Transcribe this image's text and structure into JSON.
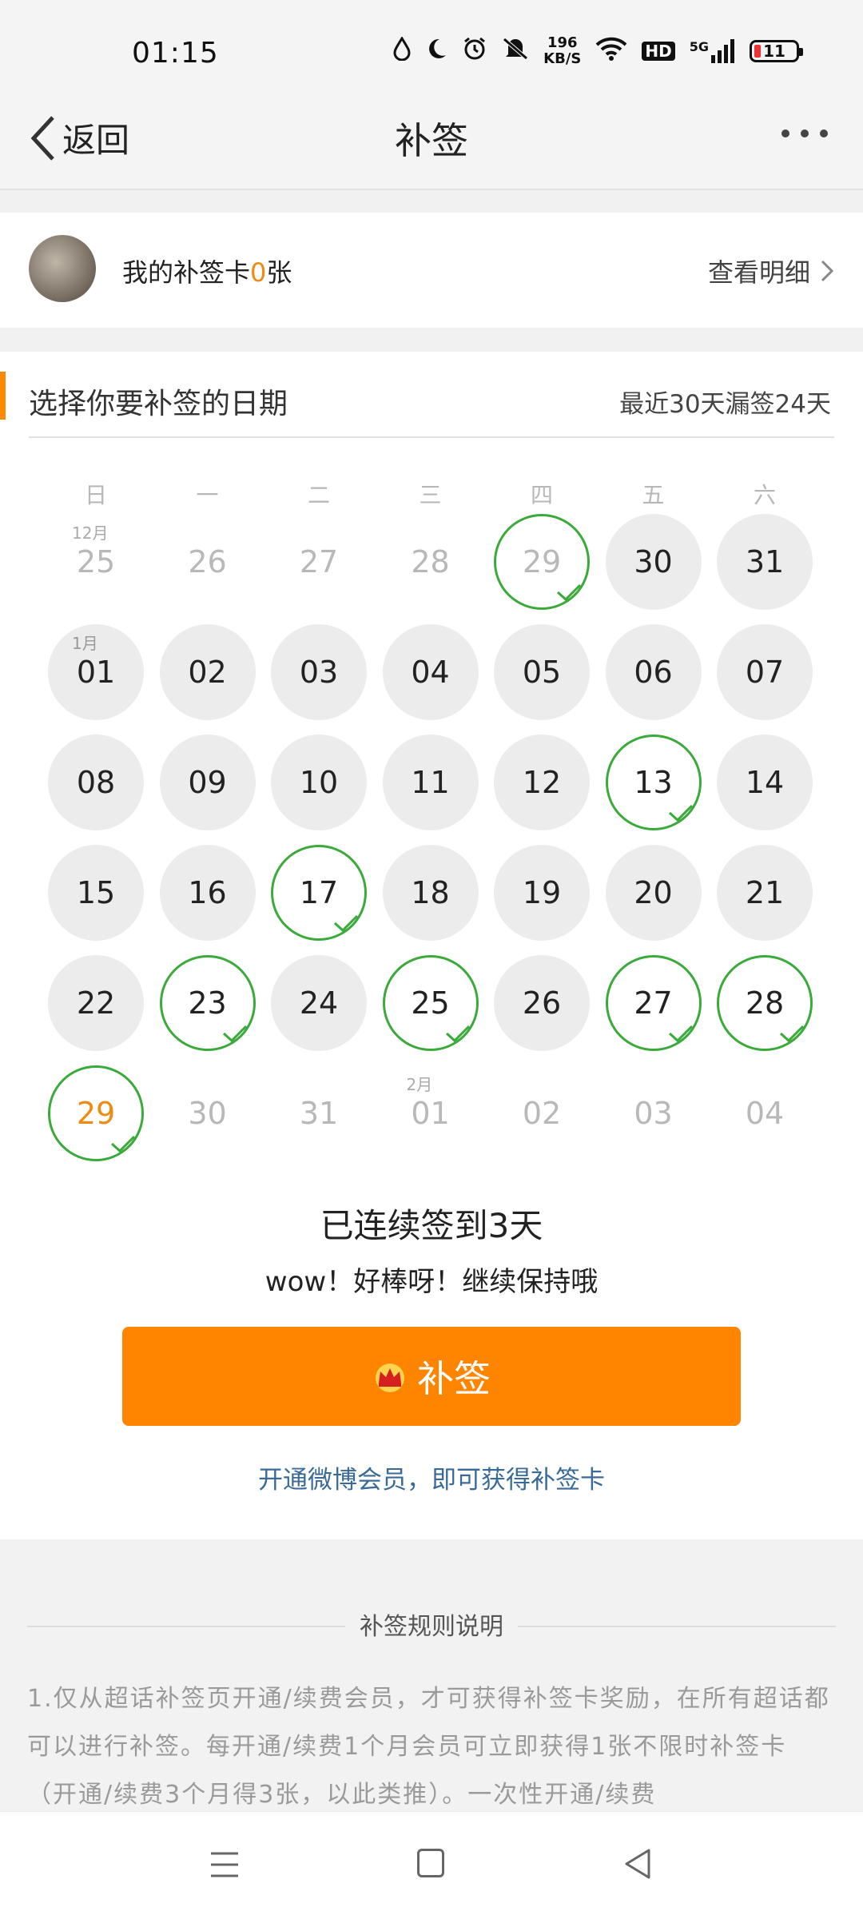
{
  "status_bar": {
    "time": "01:15",
    "net_speed_value": "196",
    "net_speed_unit": "KB/S",
    "hd_label": "HD",
    "network_label": "5G",
    "battery": "11"
  },
  "nav": {
    "back_label": "返回",
    "title": "补签"
  },
  "card": {
    "prefix": "我的补签卡",
    "count": "0",
    "suffix": "张",
    "detail_label": "查看明细"
  },
  "section": {
    "title": "选择你要补签的日期",
    "summary": "最近30天漏签24天"
  },
  "calendar": {
    "weekdays": [
      "日",
      "一",
      "二",
      "三",
      "四",
      "五",
      "六"
    ],
    "weeks": [
      [
        {
          "d": "25",
          "s": "dim",
          "m": "12月"
        },
        {
          "d": "26",
          "s": "dim"
        },
        {
          "d": "27",
          "s": "dim"
        },
        {
          "d": "28",
          "s": "dim"
        },
        {
          "d": "29",
          "s": "dim-signed"
        },
        {
          "d": "30",
          "s": "cur"
        },
        {
          "d": "31",
          "s": "cur"
        }
      ],
      [
        {
          "d": "01",
          "s": "cur",
          "m": "1月"
        },
        {
          "d": "02",
          "s": "cur"
        },
        {
          "d": "03",
          "s": "cur"
        },
        {
          "d": "04",
          "s": "cur"
        },
        {
          "d": "05",
          "s": "cur"
        },
        {
          "d": "06",
          "s": "cur"
        },
        {
          "d": "07",
          "s": "cur"
        }
      ],
      [
        {
          "d": "08",
          "s": "cur"
        },
        {
          "d": "09",
          "s": "cur"
        },
        {
          "d": "10",
          "s": "cur"
        },
        {
          "d": "11",
          "s": "cur"
        },
        {
          "d": "12",
          "s": "cur"
        },
        {
          "d": "13",
          "s": "signed"
        },
        {
          "d": "14",
          "s": "cur"
        }
      ],
      [
        {
          "d": "15",
          "s": "cur"
        },
        {
          "d": "16",
          "s": "cur"
        },
        {
          "d": "17",
          "s": "signed"
        },
        {
          "d": "18",
          "s": "cur"
        },
        {
          "d": "19",
          "s": "cur"
        },
        {
          "d": "20",
          "s": "cur"
        },
        {
          "d": "21",
          "s": "cur"
        }
      ],
      [
        {
          "d": "22",
          "s": "cur"
        },
        {
          "d": "23",
          "s": "signed"
        },
        {
          "d": "24",
          "s": "cur"
        },
        {
          "d": "25",
          "s": "signed"
        },
        {
          "d": "26",
          "s": "cur"
        },
        {
          "d": "27",
          "s": "signed"
        },
        {
          "d": "28",
          "s": "signed"
        }
      ],
      [
        {
          "d": "29",
          "s": "today"
        },
        {
          "d": "30",
          "s": "dim"
        },
        {
          "d": "31",
          "s": "dim"
        },
        {
          "d": "01",
          "s": "dim",
          "m": "2月"
        },
        {
          "d": "02",
          "s": "dim"
        },
        {
          "d": "03",
          "s": "dim"
        },
        {
          "d": "04",
          "s": "dim"
        }
      ]
    ]
  },
  "streak": "已连续签到3天",
  "cheer": "wow！好棒呀！继续保持哦",
  "button_label": "补签",
  "vip_link": "开通微博会员，即可获得补签卡",
  "rules": {
    "title": "补签规则说明",
    "text": "1.仅从超话补签页开通/续费会员，才可获得补签卡奖励，在所有超话都可以进行补签。每开通/续费1个月会员可立即获得1张不限时补签卡（开通/续费3个月得3张，以此类推）。一次性开通/续费"
  },
  "colors": {
    "accent": "#ff8400",
    "signed": "#3aaa3a",
    "link": "#3a6b98"
  }
}
